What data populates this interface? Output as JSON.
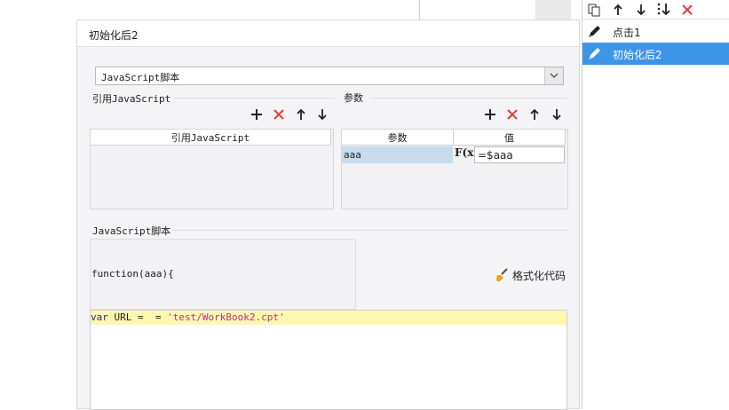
{
  "dialog": {
    "title": "初始化后2",
    "script_type_value": "JavaScript脚本",
    "ref_js_section_title": "引用JavaScript",
    "ref_js_column_header": "引用JavaScript",
    "params_section_title": "参数",
    "params_columns": [
      "参数",
      "值"
    ],
    "params_rows": [
      {
        "name": "aaa",
        "formula_icon": "F(x)",
        "value": "=$aaa"
      }
    ],
    "script_section_title": "JavaScript脚本",
    "function_signature": "function(aaa){",
    "format_button_label": "格式化代码",
    "code_line": {
      "keyword": "var",
      "plain": " URL =  = ",
      "string": "'test/WorkBook2.cpt'"
    }
  },
  "right_panel": {
    "items": [
      {
        "label": "点击1",
        "selected": false
      },
      {
        "label": "初始化后2",
        "selected": true
      }
    ]
  },
  "colors": {
    "selected_bg": "#3d95e8",
    "delete_red": "#e53935",
    "code_highlight": "#fff9b0",
    "keyword": "#1f1fb8",
    "string": "#c62b8c",
    "param_cell": "#c8dcec"
  }
}
